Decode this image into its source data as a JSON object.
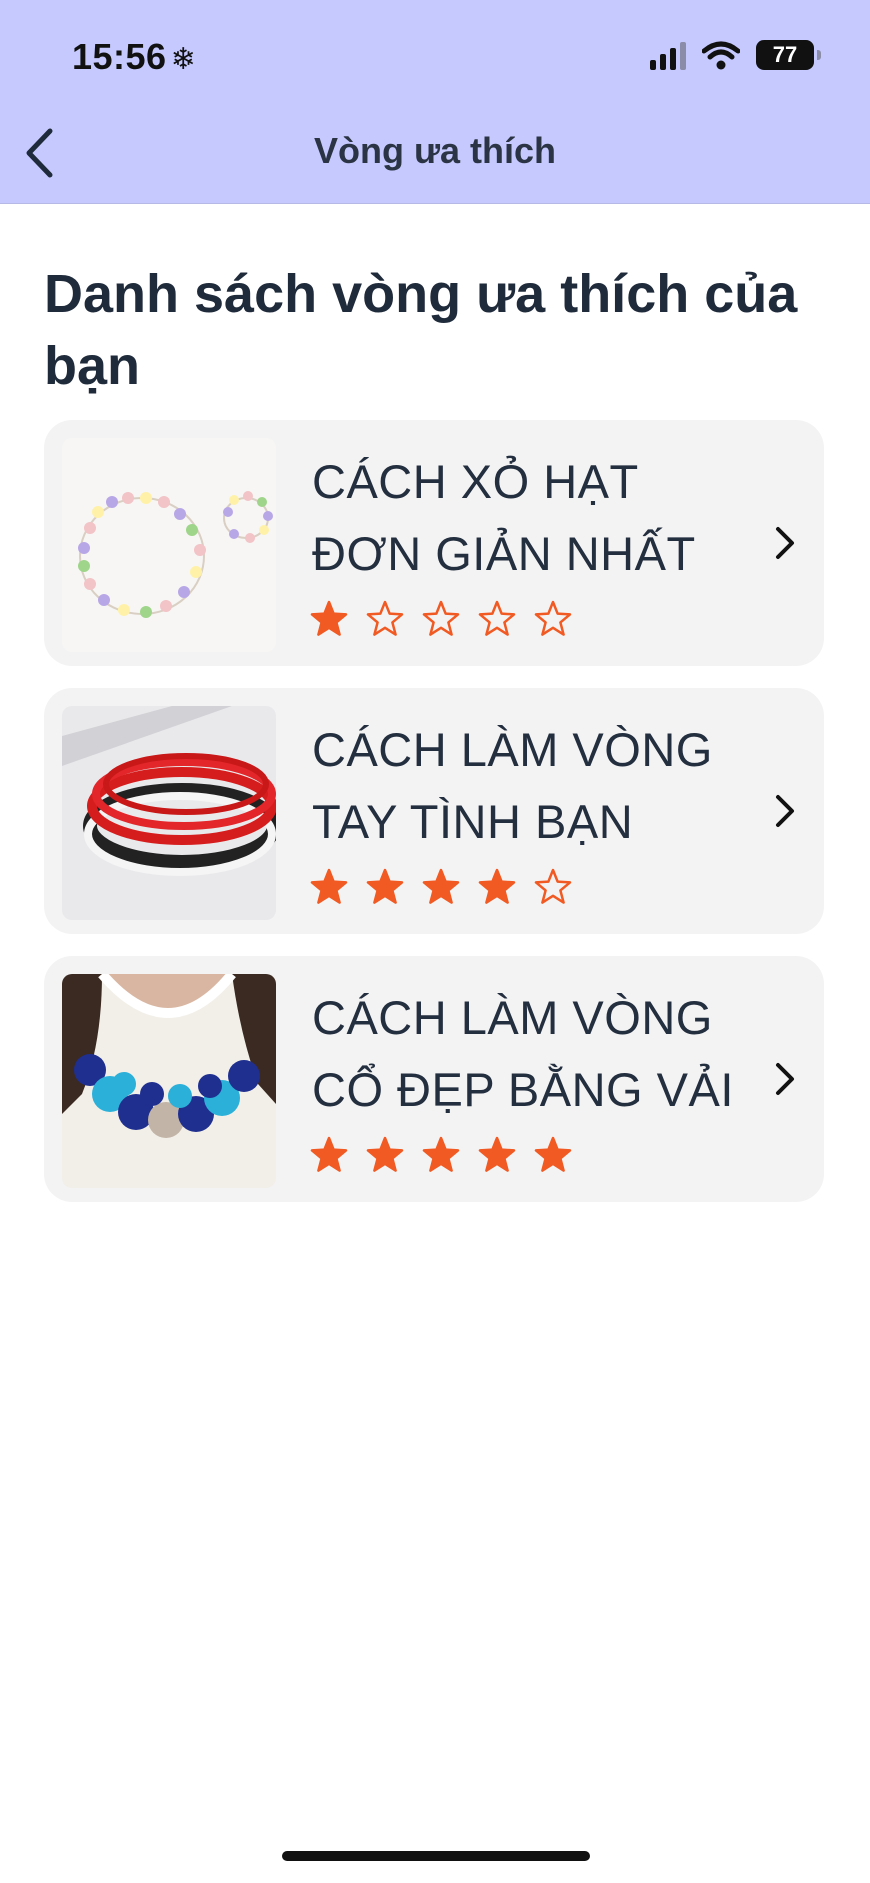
{
  "status_bar": {
    "time": "15:56",
    "battery": "77"
  },
  "nav": {
    "title": "Vòng ưa thích"
  },
  "page": {
    "heading": "Danh sách vòng ưa thích của bạn"
  },
  "items": [
    {
      "title": "CÁCH XỎ HẠT ĐƠN GIẢN NHẤT",
      "rating": 1,
      "max_rating": 5,
      "image": "beaded-necklace-and-bracelet"
    },
    {
      "title": "CÁCH LÀM VÒNG TAY TÌNH BẠN",
      "rating": 4,
      "max_rating": 5,
      "image": "red-black-woven-bracelets"
    },
    {
      "title": "CÁCH LÀM VÒNG CỔ ĐẸP BẰNG VẢI",
      "rating": 5,
      "max_rating": 5,
      "image": "blue-fabric-necklace"
    }
  ],
  "colors": {
    "header_bg": "#c5c9fd",
    "star": "#f15a22",
    "card_bg": "#f3f3f4"
  }
}
